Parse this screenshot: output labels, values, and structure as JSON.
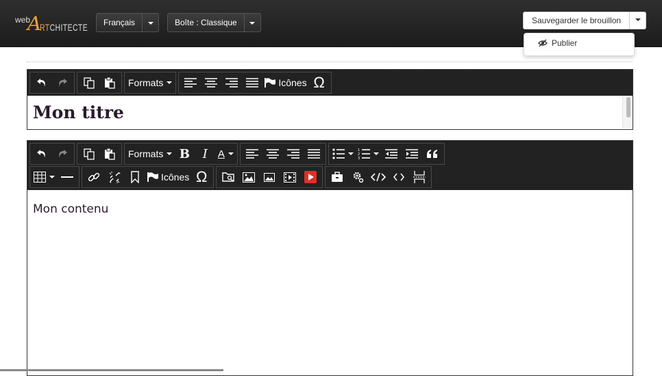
{
  "logo": {
    "web": "web",
    "a": "A",
    "rest_orange": "RT",
    "rest_white": "CHITECTE"
  },
  "header": {
    "language": {
      "label": "Français"
    },
    "box": {
      "label": "Boîte : Classique"
    },
    "save": {
      "label": "Sauvegarder le brouillon"
    },
    "dropdown": {
      "publish_label": "Publier"
    }
  },
  "title_editor": {
    "toolbar": {
      "formats_label": "Formats",
      "icons_label": "Icônes"
    },
    "title": "Mon titre"
  },
  "content_editor": {
    "toolbar": {
      "formats_label": "Formats",
      "icons_label": "Icônes",
      "bold": "B",
      "italic": "I",
      "text_color": "A",
      "omega": "Ω"
    },
    "content": "Mon contenu"
  },
  "colors": {
    "topbar": "#222222",
    "logo_accent": "#e8a33a",
    "toolbar": "#222222",
    "title_text": "#2a1a2e"
  }
}
